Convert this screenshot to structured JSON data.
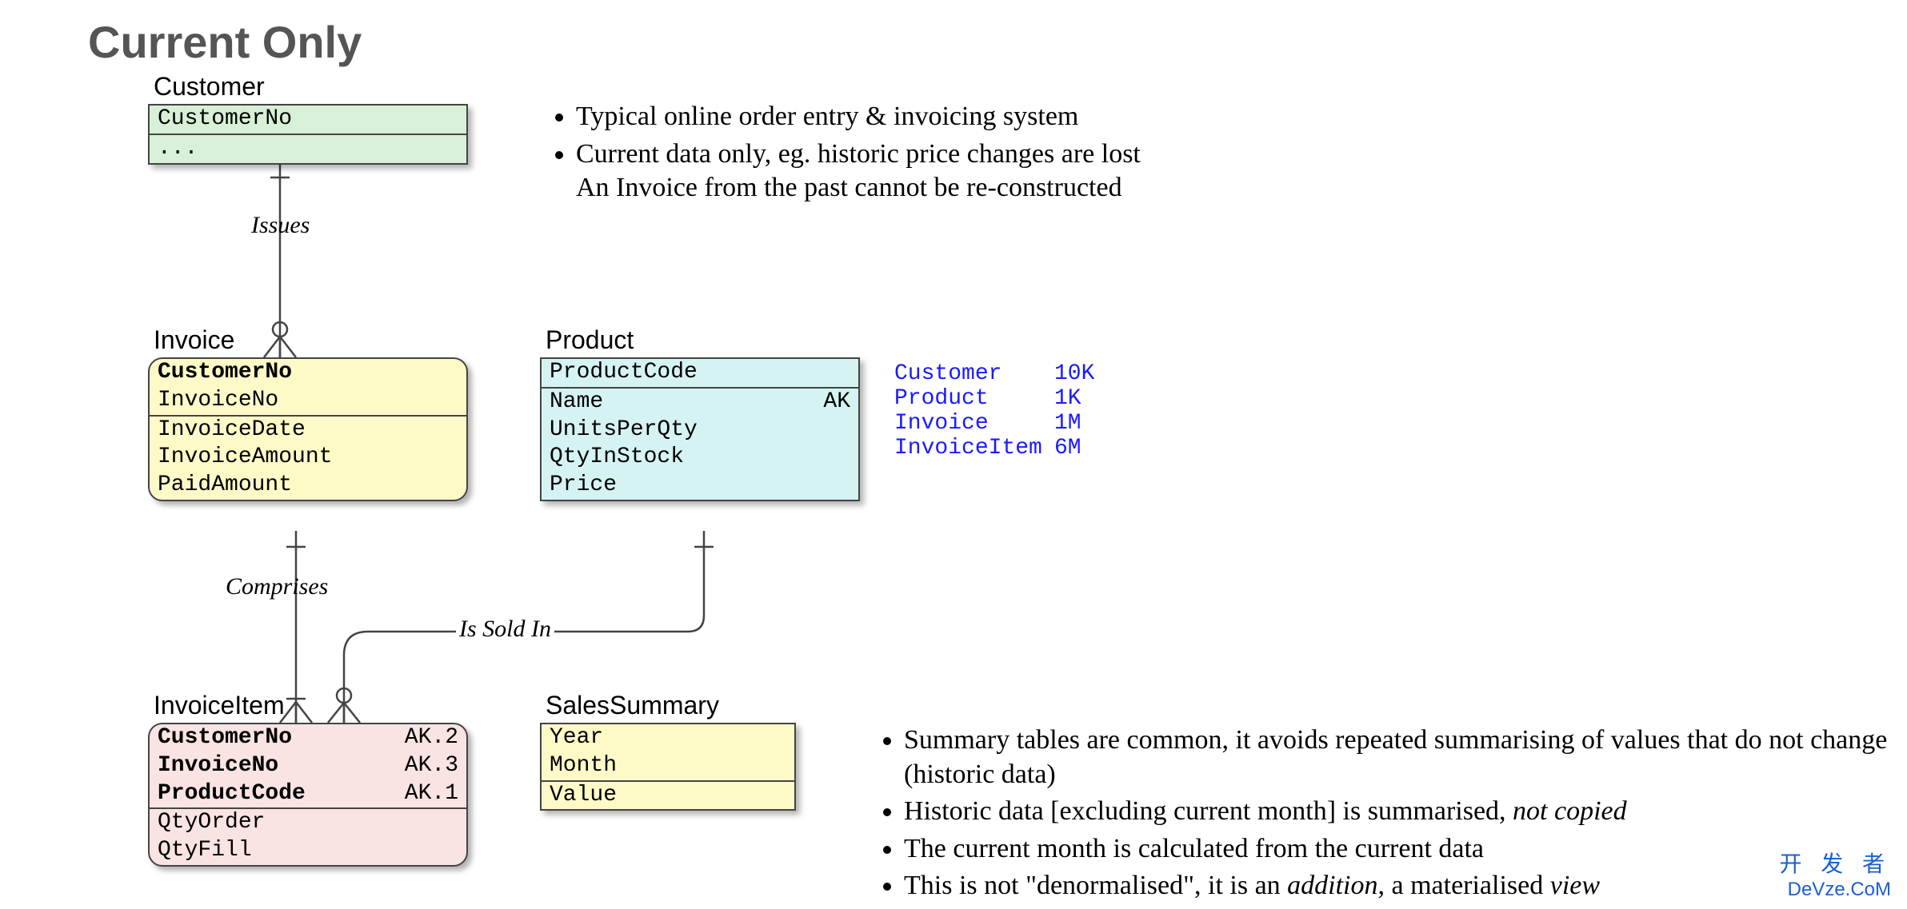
{
  "title": "Current Only",
  "entities": {
    "customer": {
      "label": "Customer",
      "pk": "CustomerNo",
      "rest": "..."
    },
    "invoice": {
      "label": "Invoice",
      "pk1": "CustomerNo",
      "pk2": "InvoiceNo",
      "a1": "InvoiceDate",
      "a2": "InvoiceAmount",
      "a3": "PaidAmount"
    },
    "product": {
      "label": "Product",
      "pk": "ProductCode",
      "a1": "Name",
      "a1_ak": "AK",
      "a2": "UnitsPerQty",
      "a3": "QtyInStock",
      "a4": "Price"
    },
    "invoiceitem": {
      "label": "InvoiceItem",
      "pk1": "CustomerNo",
      "pk1_ak": "AK.2",
      "pk2": "InvoiceNo",
      "pk2_ak": "AK.3",
      "pk3": "ProductCode",
      "pk3_ak": "AK.1",
      "a1": "QtyOrder",
      "a2": "QtyFill"
    },
    "salessummary": {
      "label": "SalesSummary",
      "pk1": "Year",
      "pk2": "Month",
      "a1": "Value"
    }
  },
  "relationships": {
    "issues": "Issues",
    "comprises": "Comprises",
    "is_sold_in": "Is Sold In"
  },
  "bullets_top": {
    "b1": "Typical online order entry & invoicing system",
    "b2": "Current data only, eg. historic price changes are lost",
    "b2_sub": "An Invoice from the past cannot be re-constructed"
  },
  "stats": {
    "customer_n": "Customer",
    "customer_v": "10K",
    "product_n": "Product",
    "product_v": "1K",
    "invoice_n": "Invoice",
    "invoice_v": "1M",
    "invoiceitem_n": "InvoiceItem",
    "invoiceitem_v": "6M"
  },
  "bullets_bottom": {
    "b1": "Summary tables are common, it avoids repeated summarising of values that do not change (historic data)",
    "b2_pre": "Historic data [excluding current month] is summarised, ",
    "b2_em": "not copied",
    "b3": "The current month is calculated from the current data",
    "b4_pre": "This is not \"denormalised\", it is an ",
    "b4_em1": "addition",
    "b4_mid": ", a materialised ",
    "b4_em2": "view"
  },
  "watermark": {
    "cn": "开 发 者",
    "en": "DeVze.CoM"
  }
}
